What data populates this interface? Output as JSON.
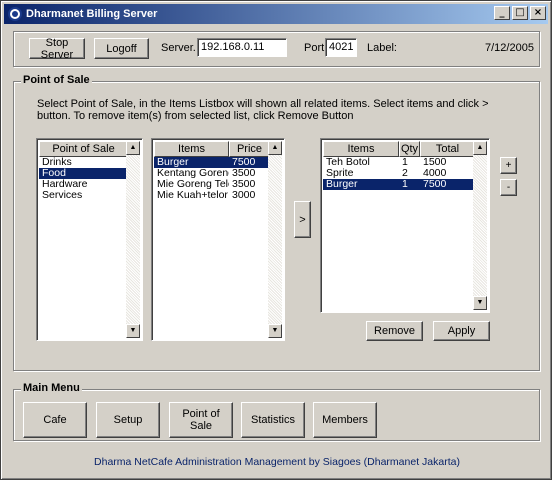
{
  "window": {
    "title": "Dharmanet Billing Server"
  },
  "toolbar": {
    "stop_server": "Stop Server",
    "logoff": "Logoff",
    "server_label": "Server.",
    "server_value": "192.168.0.11",
    "port_label": "Port",
    "port_value": "4021",
    "label_label": "Label:",
    "date": "7/12/2005"
  },
  "pos": {
    "title": "Point of Sale",
    "instructions": "Select Point of Sale, in the Items Listbox will shown all related items. Select items and click > button. To remove item(s) from selected list, click Remove Button",
    "categories": {
      "header": "Point of Sale",
      "items": [
        "Drinks",
        "Food",
        "Hardware",
        "Services"
      ],
      "selected_index": 1
    },
    "items": {
      "headers": [
        "Items",
        "Price"
      ],
      "rows": [
        [
          "Burger",
          "7500"
        ],
        [
          "Kentang Goreng",
          "3500"
        ],
        [
          "Mie Goreng Telor",
          "3500"
        ],
        [
          "Mie Kuah+telor",
          "3000"
        ]
      ],
      "selected_index": 0
    },
    "add_button": ">",
    "selected": {
      "headers": [
        "Items",
        "Qty",
        "Total"
      ],
      "rows": [
        [
          "Teh Botol",
          "1",
          "1500"
        ],
        [
          "Sprite",
          "2",
          "4000"
        ],
        [
          "Burger",
          "1",
          "7500"
        ]
      ],
      "selected_index": 2
    },
    "plus_button": "+",
    "minus_button": "-",
    "remove_button": "Remove",
    "apply_button": "Apply"
  },
  "main_menu": {
    "title": "Main Menu",
    "buttons": [
      "Cafe",
      "Setup",
      "Point of Sale",
      "Statistics",
      "Members"
    ]
  },
  "footer": "Dharma NetCafe Administration Management by Siagoes (Dharmanet Jakarta)",
  "colors": {
    "selection": "#0a246a",
    "face": "#d4d0c8",
    "footer_text": "#0a246a"
  },
  "window_controls": {
    "minimize": "_",
    "maximize": "□",
    "close": "×"
  }
}
